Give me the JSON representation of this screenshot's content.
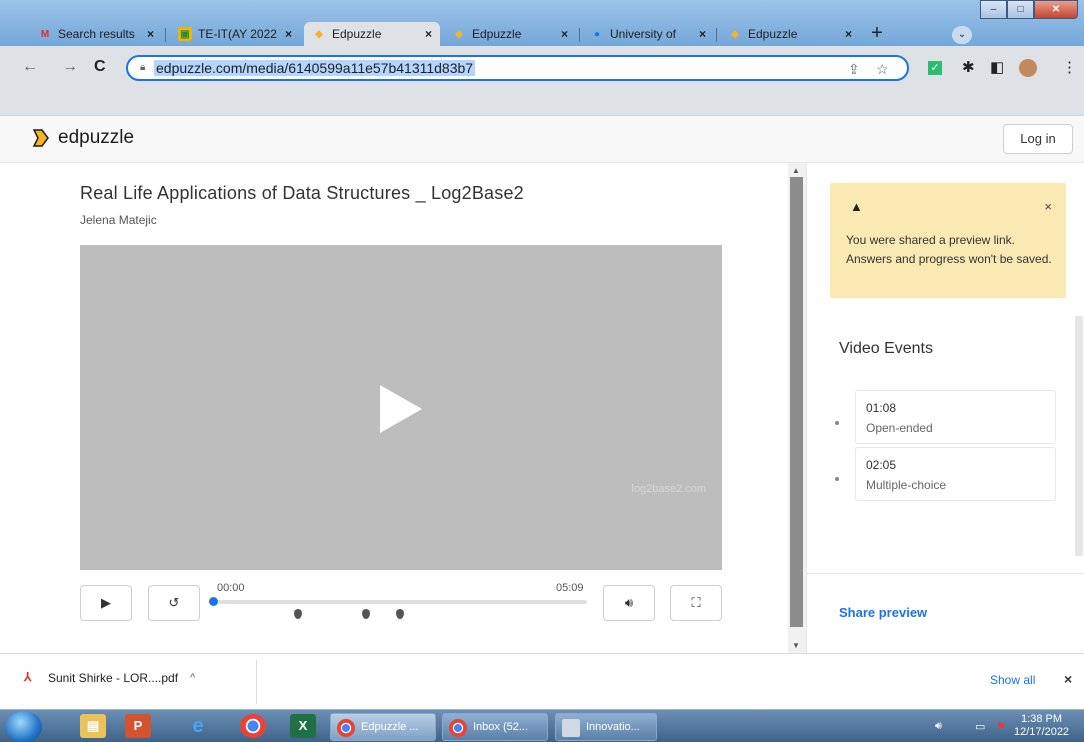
{
  "browser": {
    "tabs": [
      {
        "title": "Search results",
        "icon": "gmail-icon"
      },
      {
        "title": "TE-IT(AY 2022",
        "icon": "classroom-icon"
      },
      {
        "title": "Edpuzzle",
        "icon": "edpuzzle-icon",
        "active": true
      },
      {
        "title": "Edpuzzle",
        "icon": "edpuzzle-icon"
      },
      {
        "title": "University of",
        "icon": "globe-icon"
      },
      {
        "title": "Edpuzzle",
        "icon": "edpuzzle-icon"
      }
    ],
    "url": "edpuzzle.com/media/6140599a11e57b41311d83b7",
    "close_glyph": "×"
  },
  "site": {
    "logo_text": "edpuzzle",
    "login_label": "Log in"
  },
  "video": {
    "title": "Real Life Applications of Data Structures _ Log2Base2",
    "author": "Jelena Matejic",
    "watermark": "log2base2.com",
    "current_time": "00:00",
    "duration": "05:09",
    "progress": 0,
    "marker_positions_pct": [
      23,
      41,
      50
    ]
  },
  "alert": {
    "icon": "warning-icon",
    "text": "You were shared a preview link. Answers and progress won't be saved."
  },
  "events": {
    "title": "Video Events",
    "items": [
      {
        "time": "01:08",
        "kind": "Open-ended"
      },
      {
        "time": "02:05",
        "kind": "Multiple-choice"
      }
    ]
  },
  "share_label": "Share preview",
  "downloads": {
    "file": "Sunit Shirke - LOR....pdf",
    "show_all": "Show all"
  },
  "taskbar": {
    "tasks": [
      "Edpuzzle ...",
      "Inbox (52...",
      "Innovatio..."
    ],
    "time": "1:38 PM",
    "date": "12/17/2022"
  },
  "colors": {
    "accent": "#1a73e8",
    "alert_bg": "#fbe9b4",
    "player_bg": "#bdbdbe",
    "edpuzzle_yellow": "#f5b325"
  }
}
